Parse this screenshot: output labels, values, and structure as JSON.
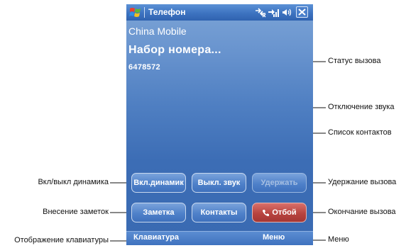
{
  "status_bar": {
    "app_title": "Телефон"
  },
  "call_screen": {
    "carrier": "China Mobile",
    "call_status": "Набор номера...",
    "phone_number": "6478572"
  },
  "buttons": {
    "speaker": "Вкл.динамик",
    "mute": "Выкл. звук",
    "hold": "Удержать",
    "note": "Заметка",
    "contacts": "Контакты",
    "end": "Отбой"
  },
  "softkeys": {
    "left": "Клавиатура",
    "right": "Меню"
  },
  "callouts": {
    "call_status": "Статус вызова",
    "mute": "Отключение звука",
    "contacts": "Список контактов",
    "speaker": "Вкл/выкл динамика",
    "hold": "Удержание вызова",
    "note": "Внесение заметок",
    "end": "Окончание вызова",
    "keypad": "Отображение клавиатуры",
    "menu": "Меню"
  },
  "colors": {
    "screen_gradient": "#4f7fc2",
    "end_button": "#b84440",
    "disabled_text": "#a6bfe2"
  }
}
